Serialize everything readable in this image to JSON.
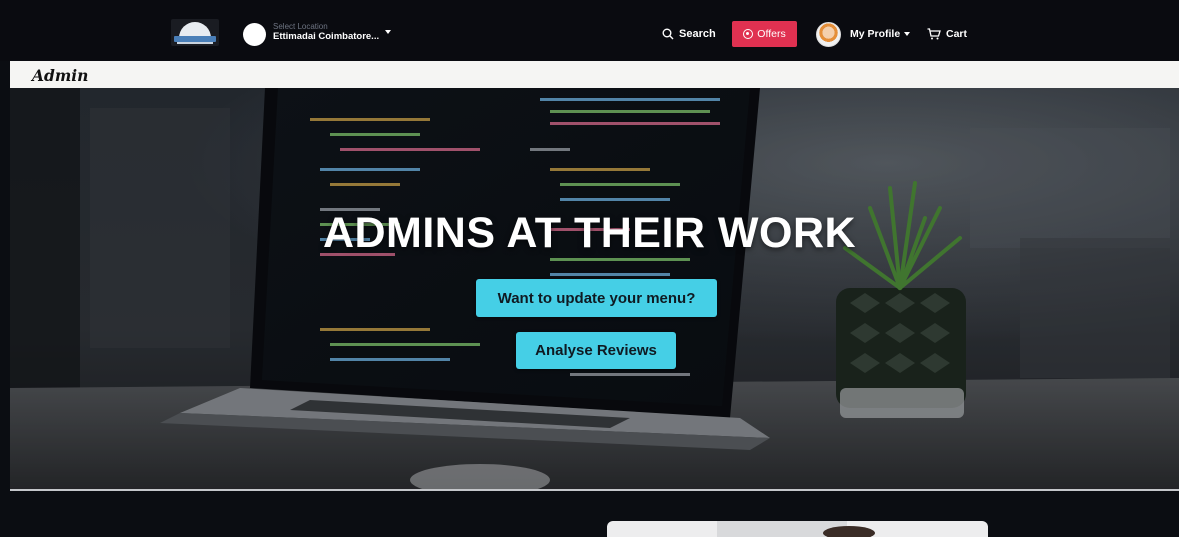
{
  "navbar": {
    "location_label": "Select Location",
    "location_value": "Ettimadai Coimbatore...",
    "search_label": "Search",
    "offers_label": "Offers",
    "profile_label": "My Profile",
    "cart_label": "Cart"
  },
  "admin_bar": {
    "title": "Admin"
  },
  "hero": {
    "title": "ADMINS AT THEIR WORK",
    "buttons": {
      "update_menu": "Want to update your menu?",
      "analyse_reviews": "Analyse Reviews"
    }
  },
  "colors": {
    "nav_bg": "#0a0b10",
    "offers_accent": "#e03151",
    "cta_accent": "#45cfe6",
    "admin_strip_bg": "#f5f5f3"
  }
}
